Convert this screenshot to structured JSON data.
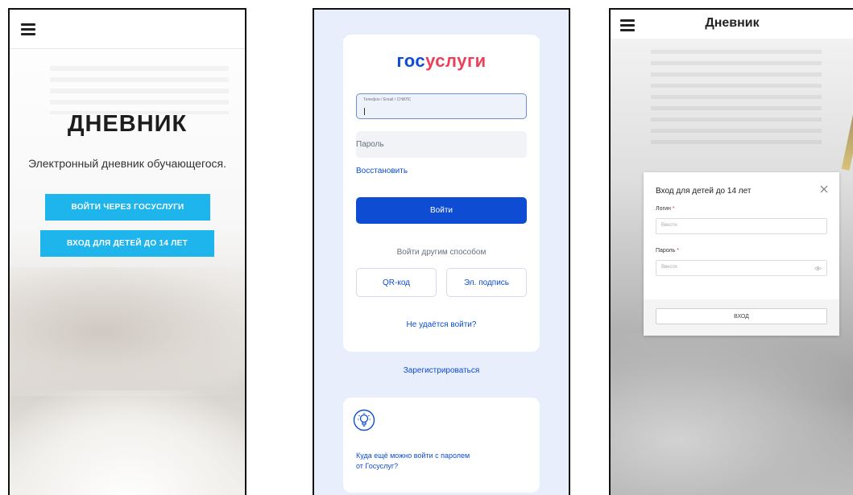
{
  "screen1": {
    "title": "ДНЕВНИК",
    "subtitle": "Электронный дневник обучающегося.",
    "gosuslugi_button": "ВОЙТИ ЧЕРЕЗ ГОСУСЛУГИ",
    "kids_button": "ВХОД ДЛЯ ДЕТЕЙ ДО 14 ЛЕТ",
    "accent_color": "#1eb5ec"
  },
  "screen2": {
    "logo_part1": "гос",
    "logo_part2": "услуги",
    "login_label": "Телефон / Email / СНИЛС",
    "password_placeholder": "Пароль",
    "restore_link": "Восстановить",
    "login_button": "Войти",
    "alt_login_text": "Войти другим способом",
    "qr_button": "QR-код",
    "signature_button": "Эл. подпись",
    "cant_login_link": "Не удаётся войти?",
    "register_link": "Зарегистрироваться",
    "where_else_text": "Куда ещё можно войти с паролем от Госуслуг?",
    "primary_color": "#0d4cd3",
    "logo_red": "#ee3f58"
  },
  "screen3": {
    "header_title": "Дневник",
    "modal_title": "Вход для детей до 14 лет",
    "login_label": "Логин",
    "password_label": "Пароль",
    "required_mark": "*",
    "login_placeholder": "Ввести",
    "password_placeholder": "Ввести",
    "submit_button": "ВХОД"
  }
}
